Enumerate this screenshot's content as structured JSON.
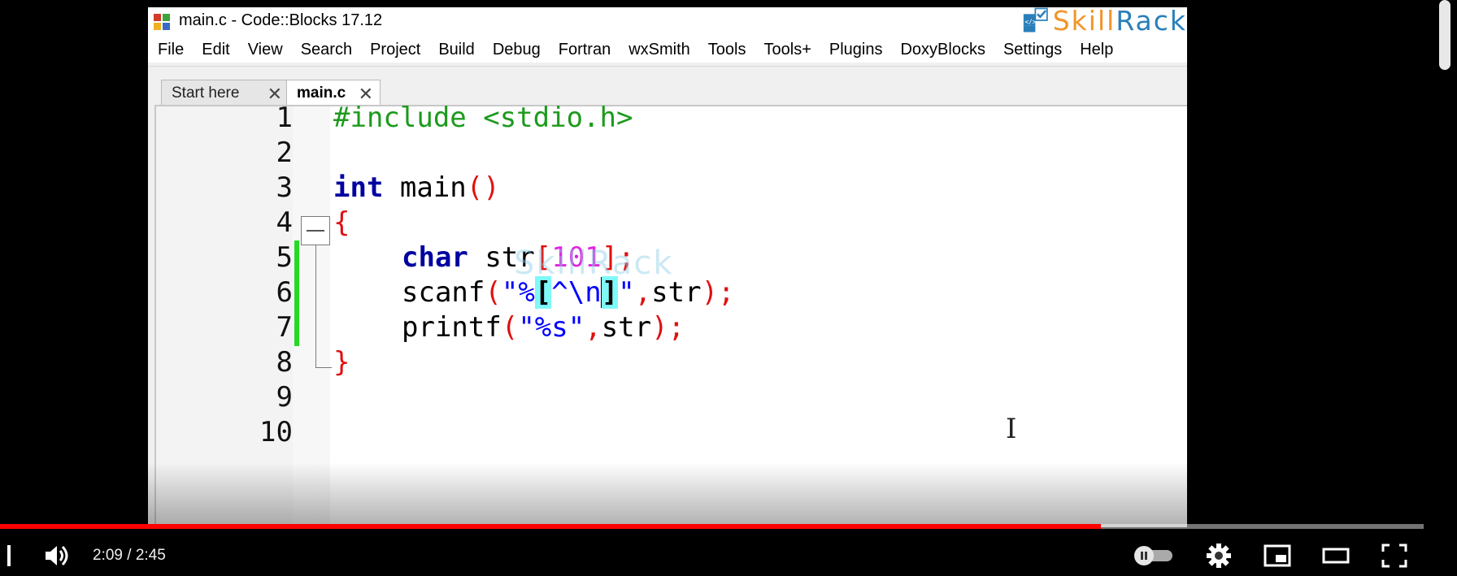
{
  "window": {
    "title": "main.c - Code::Blocks 17.12",
    "logo_skill": "Skill",
    "logo_rack": "Rack"
  },
  "menu": [
    "File",
    "Edit",
    "View",
    "Search",
    "Project",
    "Build",
    "Debug",
    "Fortran",
    "wxSmith",
    "Tools",
    "Tools+",
    "Plugins",
    "DoxyBlocks",
    "Settings",
    "Help"
  ],
  "tabs": [
    {
      "label": "Start here",
      "active": false
    },
    {
      "label": "main.c",
      "active": true
    }
  ],
  "line_numbers": [
    "1",
    "2",
    "3",
    "4",
    "5",
    "6",
    "7",
    "8",
    "9",
    "10"
  ],
  "code": {
    "line1": "#include <stdio.h>",
    "line3_kw": "int",
    "line3_rest": " main",
    "line3_parens": "()",
    "line4_brace": "{",
    "line5_kw": "char",
    "line5_name": " str",
    "line5_lb": "[",
    "line5_num": "101",
    "line5_rb": "]",
    "line5_semi": ";",
    "line6_fn": "scanf",
    "line6_lp": "(",
    "line6_q1": "\"%",
    "line6_lb": "[",
    "line6_mid1": "^\\n",
    "line6_rb": "]",
    "line6_q2": "\"",
    "line6_comma": ",",
    "line6_arg": "str",
    "line6_end": ");",
    "line7_fn": "printf",
    "line7_lp": "(",
    "line7_str": "\"%s\"",
    "line7_comma": ",",
    "line7_arg": "str",
    "line7_end": ");",
    "line8_brace": "}"
  },
  "watermark": "SkillRack",
  "player": {
    "time": "2:09 / 2:45",
    "progress": 0.7733,
    "progress_color": "#ff0000"
  },
  "colors": {
    "preprocessor": "#1d9a1d",
    "keyword": "#0000a0",
    "operator": "#e01010",
    "string": "#0000ff",
    "number": "#e025e0",
    "brace_highlight": "#7ff8f8",
    "change_bar": "#26d926"
  }
}
